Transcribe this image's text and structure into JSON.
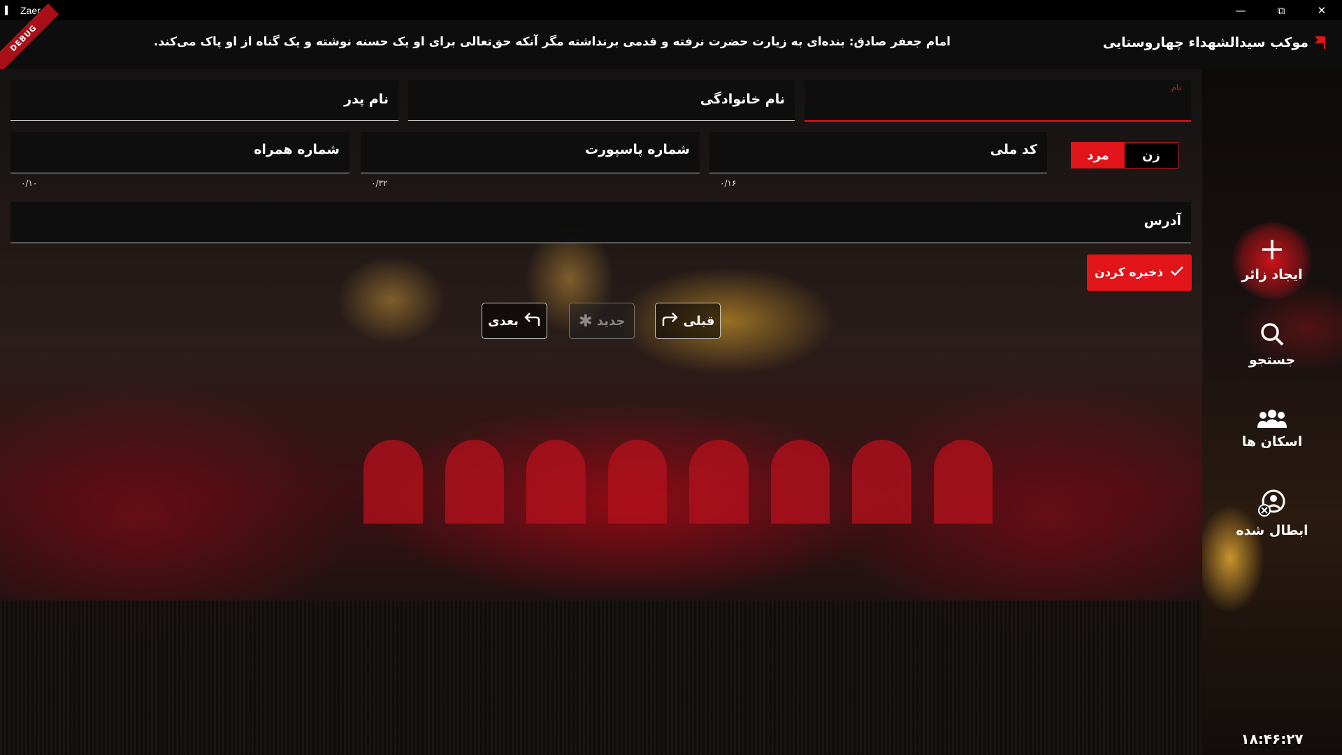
{
  "window": {
    "title": "Zaer",
    "minimize_icon": "minimize-icon",
    "restore_icon": "restore-icon",
    "close_icon": "close-icon"
  },
  "header": {
    "mowkib_name": "موکب سیدالشهداء چهاروستایی",
    "hadith": "امام جعفر صادق: بنده‌ای به زیارت حضرت نرفته و قدمی برنداشته مگر آنکه حق‌تعالی برای او یک حسنه نوشته و یک گناه از او پاک می‌کند.",
    "debug_ribbon": "DEBUG"
  },
  "form": {
    "first_name_label": "نام",
    "last_name_label": "نام خانوادگی",
    "father_name_label": "نام پدر",
    "national_code_label": "کد ملی",
    "national_code_counter": "۰/۱۶",
    "passport_label": "شماره پاسپورت",
    "passport_counter": "۰/۳۲",
    "mobile_label": "شماره همراه",
    "mobile_counter": "۰/۱۰",
    "address_label": "آدرس",
    "gender": {
      "female": "زن",
      "male": "مرد",
      "selected": "مرد"
    },
    "save_label": "ذخیره کردن"
  },
  "navigation": {
    "previous_label": "قبلی",
    "new_label": "جدید",
    "next_label": "بعدی"
  },
  "sidebar": {
    "items": [
      {
        "label": "ایجاد زائر",
        "icon": "plus-icon",
        "active": true
      },
      {
        "label": "جستجو",
        "icon": "search-icon",
        "active": false
      },
      {
        "label": "اسکان ها",
        "icon": "users-icon",
        "active": false
      },
      {
        "label": "ابطال شده",
        "icon": "user-cancel-icon",
        "active": false
      }
    ],
    "clock": "۱۸:۴۶:۲۷"
  },
  "colors": {
    "accent": "#e1141a",
    "header_bg": "#0d0d0d",
    "field_bg": "#0e0e0e"
  }
}
